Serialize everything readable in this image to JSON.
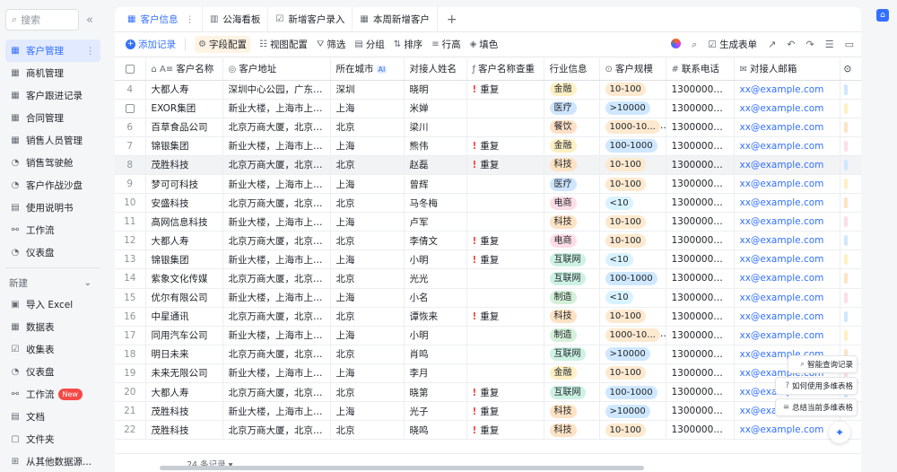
{
  "sidebar": {
    "search_placeholder": "搜索",
    "items": [
      {
        "label": "客户管理",
        "icon": "table-icon",
        "active": true
      },
      {
        "label": "商机管理",
        "icon": "table-icon"
      },
      {
        "label": "客户跟进记录",
        "icon": "table-icon"
      },
      {
        "label": "合同管理",
        "icon": "table-icon"
      },
      {
        "label": "销售人员管理",
        "icon": "table-icon"
      },
      {
        "label": "销售驾驶舱",
        "icon": "dashboard-icon"
      },
      {
        "label": "客户作战沙盘",
        "icon": "dashboard-icon"
      },
      {
        "label": "使用说明书",
        "icon": "doc-icon"
      },
      {
        "label": "工作流",
        "icon": "workflow-icon"
      },
      {
        "label": "仪表盘",
        "icon": "dashboard-icon"
      }
    ],
    "new_label": "新建",
    "new_items": [
      {
        "label": "导入 Excel",
        "icon": "excel-icon"
      },
      {
        "label": "数据表",
        "icon": "table-icon"
      },
      {
        "label": "收集表",
        "icon": "form-icon"
      },
      {
        "label": "仪表盘",
        "icon": "dashboard-icon"
      },
      {
        "label": "工作流",
        "icon": "workflow-icon",
        "badge": "New"
      },
      {
        "label": "文档",
        "icon": "doc-icon"
      },
      {
        "label": "文件夹",
        "icon": "folder-icon"
      },
      {
        "label": "从其他数据源...",
        "icon": "datasource-icon"
      }
    ]
  },
  "tabs": [
    {
      "label": "客户信息",
      "active": true
    },
    {
      "label": "公海看板"
    },
    {
      "label": "新增客户录入"
    },
    {
      "label": "本周新增客户"
    }
  ],
  "toolbar": {
    "add": "添加记录",
    "field_config": "字段配置",
    "view_config": "视图配置",
    "filter": "筛选",
    "group": "分组",
    "sort": "排序",
    "row_height": "行高",
    "fill": "填色",
    "gen_form": "生成表单"
  },
  "columns": [
    "客户名称",
    "客户地址",
    "所在城市",
    "对接人姓名",
    "客户名称查重",
    "行业信息",
    "客户规模",
    "联系电话",
    "对接人邮箱"
  ],
  "city_ai_label": "AI",
  "rows": [
    {
      "n": "4",
      "name": "大都人寿",
      "addr": "深圳中心公园，广东省...",
      "city": "深圳",
      "contact": "晓明",
      "dup": "重复",
      "industry": "金融",
      "scale": "10-100",
      "phone": "13000000000",
      "email": "xx@example.com"
    },
    {
      "n": "",
      "name": "EXOR集团",
      "addr": "新业大楼，上海市上海...",
      "city": "上海",
      "contact": "米婵",
      "dup": "",
      "industry": "医疗",
      "scale": ">10000",
      "phone": "13000000000",
      "email": "xx@example.com"
    },
    {
      "n": "6",
      "name": "百草食品公司",
      "addr": "北京万商大厦，北京市...",
      "city": "北京",
      "contact": "梁川",
      "dup": "",
      "industry": "餐饮",
      "scale": "1000-10...",
      "phone": "13000000000",
      "email": "xx@example.com"
    },
    {
      "n": "7",
      "name": "锦银集团",
      "addr": "新业大楼，上海市上海...",
      "city": "上海",
      "contact": "熊伟",
      "dup": "重复",
      "industry": "金融",
      "scale": "100-1000",
      "phone": "13000000000",
      "email": "xx@example.com"
    },
    {
      "n": "8",
      "name": "茂胜科技",
      "addr": "北京万商大厦，北京市...",
      "city": "北京",
      "contact": "赵磊",
      "dup": "重复",
      "industry": "科技",
      "scale": "10-100",
      "phone": "13000000000",
      "email": "xx@example.com"
    },
    {
      "n": "9",
      "name": "梦可可科技",
      "addr": "新业大楼，上海市上海...",
      "city": "上海",
      "contact": "曾辉",
      "dup": "",
      "industry": "医疗",
      "scale": "10-100",
      "phone": "13000000000",
      "email": "xx@example.com"
    },
    {
      "n": "10",
      "name": "安盛科技",
      "addr": "北京万商大厦，北京市...",
      "city": "北京",
      "contact": "马冬梅",
      "dup": "",
      "industry": "电商",
      "scale": "<10",
      "phone": "13000000000",
      "email": "xx@example.com"
    },
    {
      "n": "11",
      "name": "高网信息科技",
      "addr": "新业大楼，上海市上海...",
      "city": "上海",
      "contact": "卢军",
      "dup": "",
      "industry": "科技",
      "scale": "10-100",
      "phone": "13000000000",
      "email": "xx@example.com"
    },
    {
      "n": "12",
      "name": "大都人寿",
      "addr": "北京万商大厦，北京市...",
      "city": "北京",
      "contact": "李倩文",
      "dup": "重复",
      "industry": "电商",
      "scale": "10-100",
      "phone": "13000000000",
      "email": "xx@example.com"
    },
    {
      "n": "13",
      "name": "锦银集团",
      "addr": "新业大楼，上海市上海...",
      "city": "上海",
      "contact": "小明",
      "dup": "重复",
      "industry": "互联网",
      "scale": "<10",
      "phone": "13000000000",
      "email": "xx@example.com"
    },
    {
      "n": "14",
      "name": "紫象文化传媒",
      "addr": "北京万商大厦，北京市...",
      "city": "北京",
      "contact": "光光",
      "dup": "",
      "industry": "互联网",
      "scale": "100-1000",
      "phone": "13000000000",
      "email": "xx@example.com"
    },
    {
      "n": "15",
      "name": "优尔有限公司",
      "addr": "新业大楼，上海市上海...",
      "city": "上海",
      "contact": "小名",
      "dup": "",
      "industry": "制造",
      "scale": "<10",
      "phone": "13000000000",
      "email": "xx@example.com"
    },
    {
      "n": "16",
      "name": "中星通讯",
      "addr": "北京万商大厦，北京市...",
      "city": "北京",
      "contact": "谭恢来",
      "dup": "重复",
      "industry": "科技",
      "scale": "10-100",
      "phone": "13000000000",
      "email": "xx@example.com"
    },
    {
      "n": "17",
      "name": "同用汽车公司",
      "addr": "新业大楼，上海市上海...",
      "city": "上海",
      "contact": "小明",
      "dup": "",
      "industry": "制造",
      "scale": "1000-10...",
      "phone": "13000000000",
      "email": "xx@example.com"
    },
    {
      "n": "18",
      "name": "明日未来",
      "addr": "北京万商大厦，北京市...",
      "city": "北京",
      "contact": "肖鸣",
      "dup": "",
      "industry": "互联网",
      "scale": ">10000",
      "phone": "13000000000",
      "email": "xx@example.com"
    },
    {
      "n": "19",
      "name": "未来无限公司",
      "addr": "新业大楼，上海市上海...",
      "city": "上海",
      "contact": "李月",
      "dup": "",
      "industry": "金融",
      "scale": "10-100",
      "phone": "13000000000",
      "email": "xx@example.com"
    },
    {
      "n": "20",
      "name": "大都人寿",
      "addr": "北京万商大厦，北京市...",
      "city": "北京",
      "contact": "晓第",
      "dup": "重复",
      "industry": "互联网",
      "scale": "100-1000",
      "phone": "13000000000",
      "email": "xx@example.com"
    },
    {
      "n": "21",
      "name": "茂胜科技",
      "addr": "新业大楼，上海市上海...",
      "city": "上海",
      "contact": "光子",
      "dup": "重复",
      "industry": "科技",
      "scale": ">10000",
      "phone": "13000000000",
      "email": "xx@example.com"
    },
    {
      "n": "22",
      "name": "茂胜科技",
      "addr": "北京万商大厦，北京市...",
      "city": "北京",
      "contact": "晓鸣",
      "dup": "重复",
      "industry": "科技",
      "scale": "10-100",
      "phone": "13000000000",
      "email": "xx@example.com"
    }
  ],
  "footer": {
    "count": "24 条记录 ▾"
  },
  "assist": {
    "smart_query": "智能查询记录",
    "how_to": "如何使用多维表格",
    "summarize": "总结当前多维表格"
  }
}
